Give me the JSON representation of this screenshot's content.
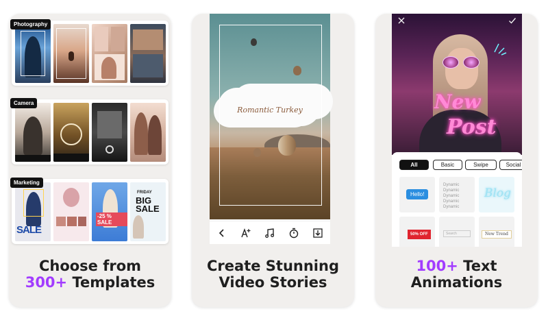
{
  "card1": {
    "sections": [
      {
        "label": "Photography"
      },
      {
        "label": "Camera"
      },
      {
        "label": "Marketing"
      }
    ],
    "marketing": {
      "sale": "SALE",
      "percent": "-25 % SALE",
      "friday": "FRIDAY",
      "big_sale": "BIG SALE"
    },
    "caption_line1": "Choose from",
    "caption_accent": "300+",
    "caption_rest": " Templates"
  },
  "card2": {
    "overlay_text": "Romantic Turkey",
    "toolbar": [
      "back-icon",
      "text-style-icon",
      "music-icon",
      "timer-icon",
      "download-icon"
    ],
    "caption_line1": "Create Stunning",
    "caption_line2": "Video Stories"
  },
  "card3": {
    "neon_line1": "New",
    "neon_line2": "Post",
    "filters": [
      {
        "label": "All",
        "active": true
      },
      {
        "label": "Basic",
        "active": false
      },
      {
        "label": "Swipe",
        "active": false
      },
      {
        "label": "Social",
        "active": false
      }
    ],
    "tiles": {
      "hello": "Hello!",
      "dynamic": "Dynamic",
      "blog": "Blog",
      "off": "50% OFF",
      "search": "Search",
      "trend": "New Trend"
    },
    "caption_accent": "100+",
    "caption_rest": " Text",
    "caption_line2": "Animations"
  },
  "colors": {
    "accent": "#a23cff",
    "card_bg": "#f1efed",
    "caption": "#1f1f1f"
  }
}
